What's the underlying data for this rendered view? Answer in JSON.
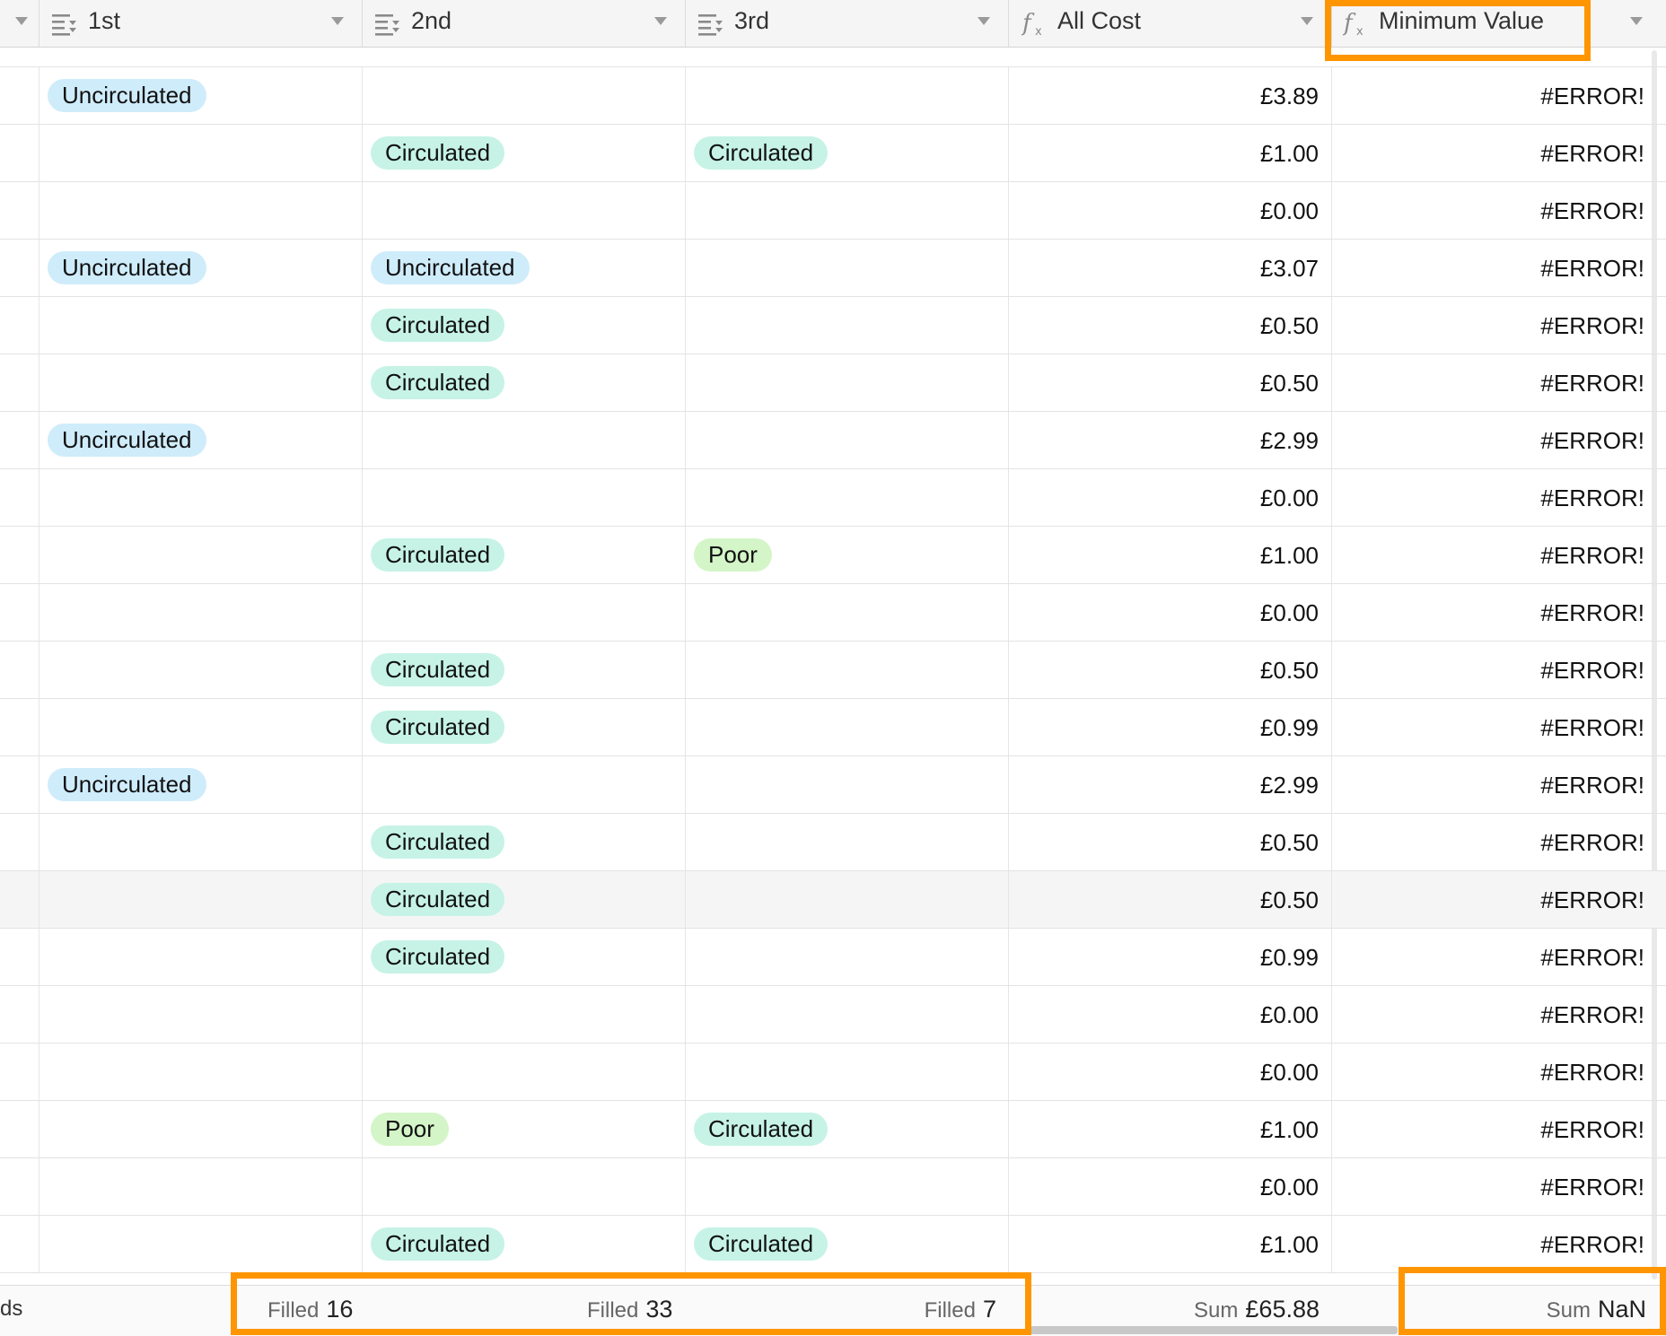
{
  "header": {
    "columns": [
      {
        "label": "1st",
        "icon": "multi-select-icon"
      },
      {
        "label": "2nd",
        "icon": "multi-select-icon"
      },
      {
        "label": "3rd",
        "icon": "multi-select-icon"
      },
      {
        "label": "All Cost",
        "icon": "formula-icon"
      },
      {
        "label": "Minimum Value",
        "icon": "formula-icon"
      }
    ]
  },
  "rows": [
    {
      "c1": "Uncirculated",
      "c2": "",
      "c3": "",
      "cost": "£3.89",
      "min": "#ERROR!"
    },
    {
      "c1": "",
      "c2": "Circulated",
      "c3": "Circulated",
      "cost": "£1.00",
      "min": "#ERROR!"
    },
    {
      "c1": "",
      "c2": "",
      "c3": "",
      "cost": "£0.00",
      "min": "#ERROR!"
    },
    {
      "c1": "Uncirculated",
      "c2": "Uncirculated",
      "c3": "",
      "cost": "£3.07",
      "min": "#ERROR!"
    },
    {
      "c1": "",
      "c2": "Circulated",
      "c3": "",
      "cost": "£0.50",
      "min": "#ERROR!"
    },
    {
      "c1": "",
      "c2": "Circulated",
      "c3": "",
      "cost": "£0.50",
      "min": "#ERROR!"
    },
    {
      "c1": "Uncirculated",
      "c2": "",
      "c3": "",
      "cost": "£2.99",
      "min": "#ERROR!"
    },
    {
      "c1": "",
      "c2": "",
      "c3": "",
      "cost": "£0.00",
      "min": "#ERROR!"
    },
    {
      "c1": "",
      "c2": "Circulated",
      "c3": "Poor",
      "cost": "£1.00",
      "min": "#ERROR!"
    },
    {
      "c1": "",
      "c2": "",
      "c3": "",
      "cost": "£0.00",
      "min": "#ERROR!"
    },
    {
      "c1": "",
      "c2": "Circulated",
      "c3": "",
      "cost": "£0.50",
      "min": "#ERROR!"
    },
    {
      "c1": "",
      "c2": "Circulated",
      "c3": "",
      "cost": "£0.99",
      "min": "#ERROR!"
    },
    {
      "c1": "Uncirculated",
      "c2": "",
      "c3": "",
      "cost": "£2.99",
      "min": "#ERROR!"
    },
    {
      "c1": "",
      "c2": "Circulated",
      "c3": "",
      "cost": "£0.50",
      "min": "#ERROR!"
    },
    {
      "c1": "",
      "c2": "Circulated",
      "c3": "",
      "cost": "£0.50",
      "min": "#ERROR!"
    },
    {
      "c1": "",
      "c2": "Circulated",
      "c3": "",
      "cost": "£0.99",
      "min": "#ERROR!"
    },
    {
      "c1": "",
      "c2": "",
      "c3": "",
      "cost": "£0.00",
      "min": "#ERROR!"
    },
    {
      "c1": "",
      "c2": "",
      "c3": "",
      "cost": "£0.00",
      "min": "#ERROR!"
    },
    {
      "c1": "",
      "c2": "Poor",
      "c3": "Circulated",
      "cost": "£1.00",
      "min": "#ERROR!"
    },
    {
      "c1": "",
      "c2": "",
      "c3": "",
      "cost": "£0.00",
      "min": "#ERROR!"
    },
    {
      "c1": "",
      "c2": "Circulated",
      "c3": "Circulated",
      "cost": "£1.00",
      "min": "#ERROR!"
    }
  ],
  "pill_colors": {
    "Uncirculated": "#cfecfb",
    "Circulated": "#c6f3e6",
    "Poor": "#d3f5c7"
  },
  "footer": {
    "records_label": "ds",
    "c1": {
      "label": "Filled",
      "value": "16"
    },
    "c2": {
      "label": "Filled",
      "value": "33"
    },
    "c3": {
      "label": "Filled",
      "value": "7"
    },
    "cost": {
      "label": "Sum",
      "value": "£65.88"
    },
    "min": {
      "label": "Sum",
      "value": "NaN"
    }
  },
  "highlight_color": "#ff9500"
}
